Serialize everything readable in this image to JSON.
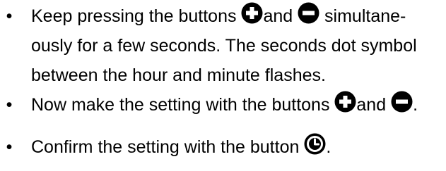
{
  "items": [
    {
      "bullet": "•",
      "lines": [
        {
          "before": "Keep pressing the buttons ",
          "between": "and ",
          "after": " simultane-"
        },
        {
          "text": "ously for a few seconds. The seconds dot symbol"
        },
        {
          "text": "between the hour and minute flashes."
        }
      ],
      "icons": [
        "plus-circle-icon",
        "minus-circle-icon"
      ]
    },
    {
      "bullet": "•",
      "before": "Now make the setting with the buttons ",
      "between": "and ",
      "after": ".",
      "icons": [
        "plus-circle-icon",
        "minus-circle-icon"
      ]
    },
    {
      "bullet": "•",
      "before": "Confirm the setting with the button ",
      "after": ".",
      "icons": [
        "clock-circle-icon"
      ]
    }
  ],
  "colors": {
    "text": "#000000",
    "icon_fill": "#000000",
    "icon_symbol": "#ffffff",
    "background": "#ffffff"
  }
}
